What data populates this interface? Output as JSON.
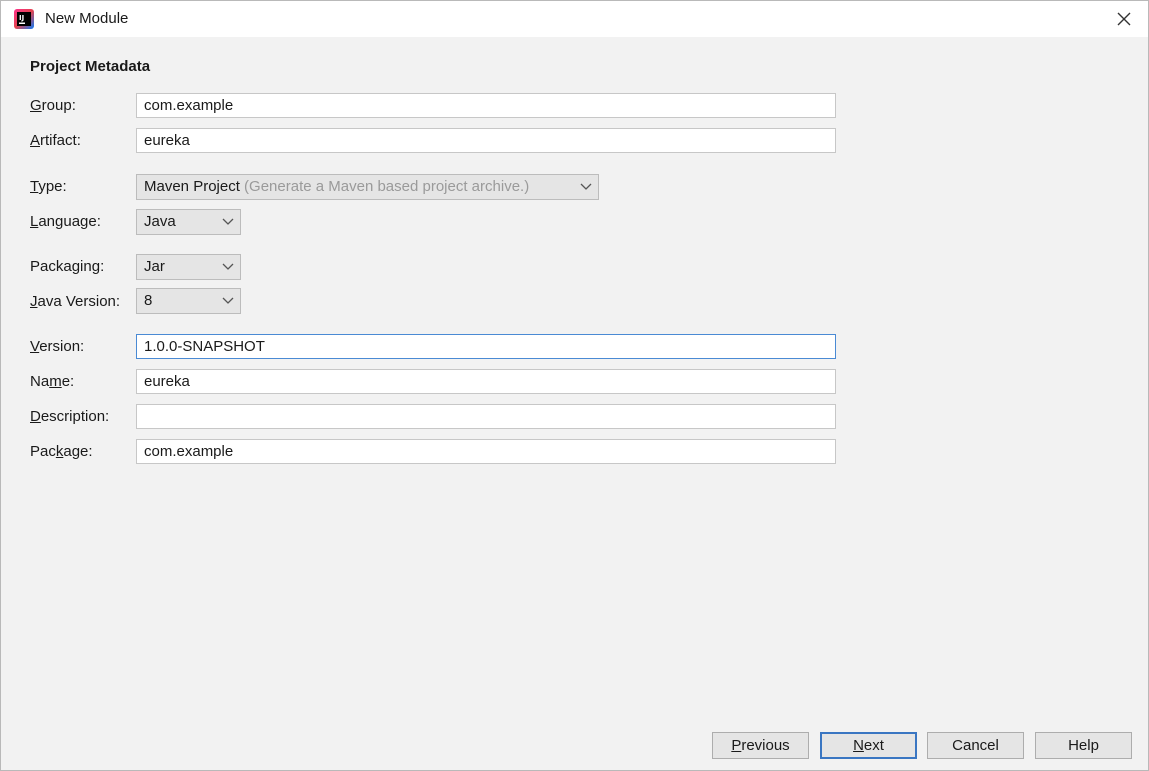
{
  "window": {
    "title": "New Module"
  },
  "section": {
    "title": "Project Metadata"
  },
  "form": {
    "group": {
      "label_mnemonic": "G",
      "label_rest": "roup:",
      "value": "com.example"
    },
    "artifact": {
      "label_mnemonic": "A",
      "label_rest": "rtifact:",
      "value": "eureka"
    },
    "type": {
      "label_mnemonic": "T",
      "label_rest": "ype:",
      "value": "Maven Project",
      "hint": "(Generate a Maven based project archive.)"
    },
    "language": {
      "label_pre": "",
      "label_mnemonic": "L",
      "label_rest": "anguage:",
      "value": "Java"
    },
    "packaging": {
      "label_pre": "Packa",
      "label_mnemonic": "g",
      "label_rest": "ing:",
      "value": "Jar"
    },
    "java_version": {
      "label_mnemonic": "J",
      "label_rest": "ava Version:",
      "value": "8"
    },
    "version": {
      "label_mnemonic": "V",
      "label_rest": "ersion:",
      "value": "1.0.0-SNAPSHOT"
    },
    "name": {
      "label_pre": "Na",
      "label_mnemonic": "m",
      "label_rest": "e:",
      "value": "eureka"
    },
    "description": {
      "label_mnemonic": "D",
      "label_rest": "escription:",
      "value": ""
    },
    "package": {
      "label_pre": "Pac",
      "label_mnemonic": "k",
      "label_rest": "age:",
      "value": "com.example"
    }
  },
  "buttons": {
    "previous": {
      "mnemonic": "P",
      "rest": "revious"
    },
    "next": {
      "mnemonic": "N",
      "rest": "ext"
    },
    "cancel": "Cancel",
    "help": "Help"
  },
  "colors": {
    "accent": "#3a76c2",
    "background": "#f2f2f2",
    "hint": "#9a9a9a"
  },
  "icons": {
    "app": "intellij-idea-icon",
    "close": "close-icon",
    "dropdown": "chevron-down-icon"
  }
}
